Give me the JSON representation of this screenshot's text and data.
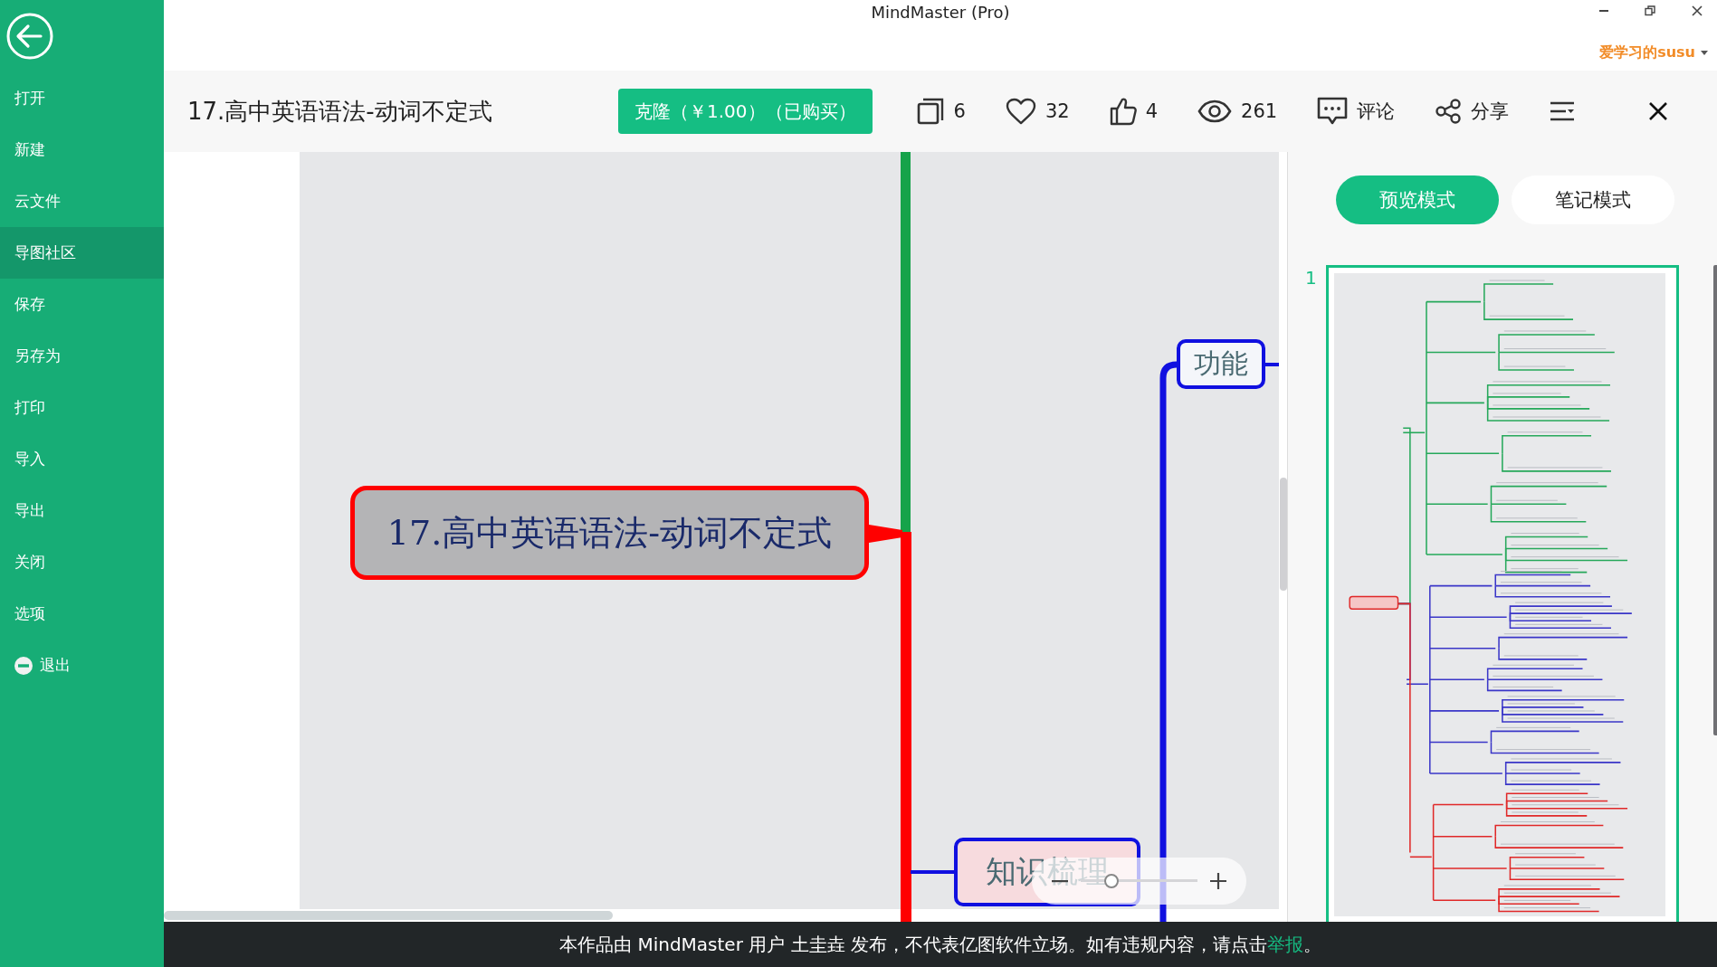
{
  "window": {
    "title": "MindMaster (Pro)"
  },
  "user": {
    "name": "爱学习的susu"
  },
  "sidebar": {
    "items": [
      {
        "label": "打开",
        "selected": false,
        "kind": "plain"
      },
      {
        "label": "新建",
        "selected": false,
        "kind": "plain"
      },
      {
        "label": "云文件",
        "selected": false,
        "kind": "plain"
      },
      {
        "label": "导图社区",
        "selected": true,
        "kind": "plain"
      },
      {
        "label": "保存",
        "selected": false,
        "kind": "plain"
      },
      {
        "label": "另存为",
        "selected": false,
        "kind": "plain"
      },
      {
        "label": "打印",
        "selected": false,
        "kind": "plain"
      },
      {
        "label": "导入",
        "selected": false,
        "kind": "plain"
      },
      {
        "label": "导出",
        "selected": false,
        "kind": "plain"
      },
      {
        "label": "关闭",
        "selected": false,
        "kind": "plain"
      },
      {
        "label": "选项",
        "selected": false,
        "kind": "plain"
      },
      {
        "label": "退出",
        "selected": false,
        "kind": "exit"
      }
    ]
  },
  "document": {
    "title": "17.高中英语语法-动词不定式",
    "clone_button": "克隆（￥1.00）（已购买）",
    "stats": [
      {
        "kind": "copies",
        "value": "6"
      },
      {
        "kind": "likes",
        "value": "32"
      },
      {
        "kind": "thumbs",
        "value": "4"
      },
      {
        "kind": "views",
        "value": "261"
      },
      {
        "kind": "comment",
        "value": "评论"
      },
      {
        "kind": "share",
        "value": "分享"
      }
    ]
  },
  "mindmap": {
    "root": "17.高中英语语法-动词不定式",
    "nodes": [
      {
        "label": "功能",
        "kind": "plain"
      },
      {
        "label": "知识梳理",
        "kind": "pink"
      }
    ]
  },
  "zoom": {
    "level": 0.2
  },
  "modes": [
    {
      "label": "预览模式",
      "selected": true
    },
    {
      "label": "笔记模式",
      "selected": false
    }
  ],
  "outline": {
    "page": "1"
  },
  "notice": {
    "before": "本作品由 MindMaster 用户 土圭垚 发布，不代表亿图软件立场。如有违规内容，请点击",
    "link": "举报",
    "after": "。"
  }
}
